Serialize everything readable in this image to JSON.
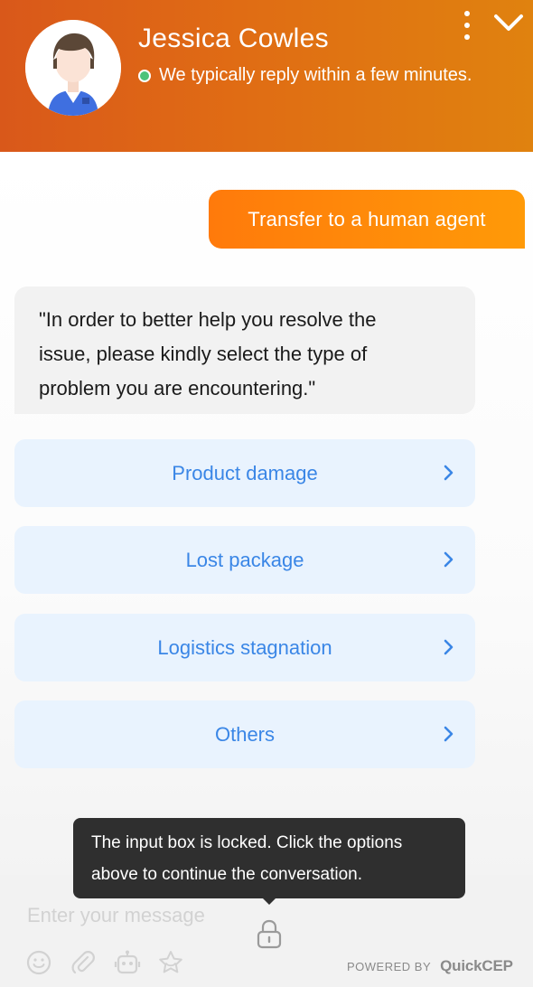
{
  "header": {
    "agent_name": "Jessica Cowles",
    "status_text": "We typically reply within a few minutes.",
    "status_color": "#4cc37a",
    "gradient_colors": [
      "#d9581a",
      "#e0820f"
    ],
    "menu_icon": "more-vertical-icon",
    "collapse_icon": "chevron-down-icon"
  },
  "conversation": {
    "user_message": "Transfer to a human agent",
    "bot_message_lines": [
      "\"In order to better help you resolve the",
      "issue, please kindly select the type of",
      "problem you are encountering.\""
    ],
    "options": [
      {
        "label": "Product damage",
        "icon": "chevron-right-icon"
      },
      {
        "label": "Lost package",
        "icon": "chevron-right-icon"
      },
      {
        "label": "Logistics stagnation",
        "icon": "chevron-right-icon"
      },
      {
        "label": "Others",
        "icon": "chevron-right-icon"
      }
    ],
    "accent_color": "#3a86e6",
    "user_bubble_color": "#ff8a0a"
  },
  "tooltip": {
    "lines": [
      "The input box is locked. Click the options",
      "above to continue the conversation."
    ]
  },
  "composer": {
    "placeholder": "Enter your message",
    "lock_icon": "lock-icon",
    "tools": [
      "emoji-icon",
      "attachment-icon",
      "robot-icon",
      "star-icon"
    ],
    "powered_by": "POWERED BY",
    "brand": "QuickCEP"
  }
}
